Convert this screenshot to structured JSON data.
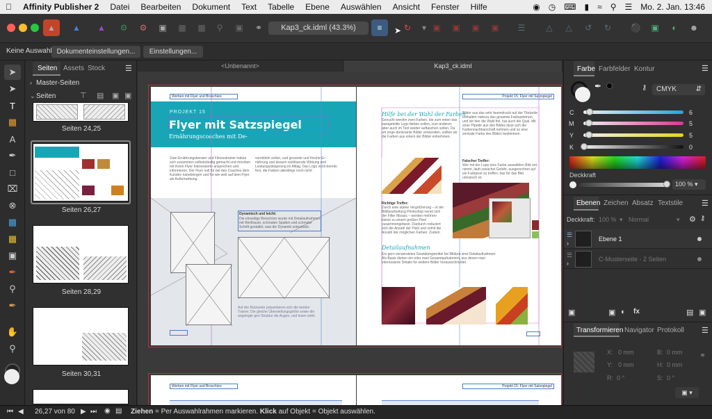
{
  "menubar": {
    "app_name": "Affinity Publisher 2",
    "items": [
      "Datei",
      "Bearbeiten",
      "Dokument",
      "Text",
      "Tabelle",
      "Ebene",
      "Auswählen",
      "Ansicht",
      "Fenster",
      "Hilfe"
    ],
    "datetime": "Mo. 2. Jan.  13:46"
  },
  "toolbar": {
    "document_title": "Kap3_ck.idml (43.3%)"
  },
  "contextbar": {
    "selection": "Keine Auswahl",
    "doc_settings": "Dokumenteinstellungen...",
    "settings": "Einstellungen..."
  },
  "pages_panel": {
    "tabs": [
      "Seiten",
      "Assets",
      "Stock"
    ],
    "master_label": "Master-Seiten",
    "pages_label": "Seiten",
    "spreads": [
      "Seiten 24,25",
      "Seiten 26,27",
      "Seiten 28,29",
      "Seiten 30,31"
    ]
  },
  "canvas": {
    "tabs": [
      "<Unbenannt>",
      "Kap3_ck.idml"
    ],
    "left_page": {
      "running_head": "Werben mit Flyer und Broschüre",
      "kicker": "PROJEKT 15",
      "title": "Flyer mit Satzspiegel",
      "subtitle": "Ernährungscoaches mit De-",
      "body1": "Zwei Ernährungsberater und Fitnesstrainer haben sich zusammen selbstständig gemacht und möchten mit ihrem Flyer Interessierte an­sprechen und informieren. Der Flyer soll für bei den Coaches dem Kunden nahebringen und für wie weit auf dem Flyer als Außenwirkung.",
      "body2": "vermitteln sollen, und gesunde und frische Er­nährung und dessen wohltuende Wirkung und Leistungssteigerung im Alltag. Das Logo nicht bereits fest, die Farben allerdings noch nicht",
      "box_title": "Dynamisch und leicht:",
      "box_text": "Die einseitige Broschüre wurde mit Detailaufnahmen, mit Weißraum, schmalen Spalten und schmaler Schrift gestaltet, was die Dynamik unterstützt.",
      "caption": "Auf der Rückseite präsentieren sich die beiden Trainer. Die gleiche Überstellungsgröße sowie die angelegte geri­ Struktur die Augen, und lesen wirkt."
    },
    "right_page": {
      "running_head": "Projekt 15: Flyer mit Satzspiegel",
      "heading1": "Hilfe bei der Wahl der Farben",
      "text1": "Gesucht werden zwei Farben, die zum einen das zweigeteilte Logo färben sollen, zum ande­ren aber auch im Text wieder auftauchen sol­len. Da wir enge-dominante Bilder verwenden, sollten wir die Farben aus einem der Bilder ent­nehmen.",
      "text2": "Bilder aus das sehr beeindruckt auf der Titel­seite enthalten nahezu das gesamte Farbspekt­rum, und wir hier die Wahl fiel, hat auch die Qual. Mit einer Pipette aus des Bildes lässt sich die Farbennachbarschaft nehmen und so eine zentrale Farbe des Bildes bestimmen.",
      "tip_title": "Falscher Treffer:",
      "tip_text": "Wer mit der Lupe eine Farbe auswählen Bild ent­nimmt, läuft zunächst Gefahr, ausgerechnet auf ein Farbpixel zu treffen, das für das Bild untypisch ist.",
      "tip2_title": "Richtige Treffer:",
      "tip2_text": "Durch eine starke Vergrößerung – in der Bildbearbeitung Photoshop nennt sich der Filter Mosaic – werden mehrere kleine zu ei­nem großen Pixel zusammengefasst. Dar­durch reduziert sich die Anzahl der Pixel und somit die Anzahl der möglichen Farben. Zu­dem werden untypische Farbpixel reduziert.",
      "heading2": "Detailaufnahmen",
      "text3": "Ein gern verwendetes Gestaltungsmittel bei Bildern sind Detailaufnah­men. Als Basis dienen ein oder zwei Gesamtaufnahmen, aus denen man interessante Details für weitere Bilder herausschneidet."
    },
    "bottom_spread": {
      "left_head": "Werben mit Flyer und Broschüre",
      "right_head": "Projekt 15: Flyer mit Satzspiegel"
    }
  },
  "right_panel": {
    "color_tabs": [
      "Farbe",
      "Farbfelder",
      "Kontur"
    ],
    "color_model": "CMYK",
    "channels": [
      {
        "label": "C",
        "value": "6",
        "level": 0.06,
        "color": "#1aa9e0"
      },
      {
        "label": "M",
        "value": "5",
        "level": 0.05,
        "color": "#d63a93"
      },
      {
        "label": "Y",
        "value": "5",
        "level": 0.05,
        "color": "#e6d31e"
      },
      {
        "label": "K",
        "value": "0",
        "level": 0.0,
        "color": "#888888"
      }
    ],
    "opacity_label": "Deckkraft",
    "opacity_value": "100 %",
    "layer_tabs": [
      "Ebenen",
      "Zeichen",
      "Absatz",
      "Textstile"
    ],
    "layer_opacity_label": "Deckkraft:",
    "layer_opacity_value": "100 %",
    "blend_mode": "Normal",
    "layers": [
      "Ebene 1",
      "C-Musterseite - 2 Seiten"
    ],
    "transform_tabs": [
      "Transformieren",
      "Navigator",
      "Protokoll"
    ],
    "fields": [
      {
        "label": "X:",
        "value": "0 mm"
      },
      {
        "label": "B:",
        "value": "0 mm"
      },
      {
        "label": "Y:",
        "value": "0 mm"
      },
      {
        "label": "H:",
        "value": "0 mm"
      },
      {
        "label": "R:",
        "value": "0 °"
      },
      {
        "label": "S:",
        "value": "0 °"
      }
    ]
  },
  "statusbar": {
    "page_indicator": "26,27 von 80",
    "hint_bold1": "Ziehen",
    "hint_text1": " = Per Auswahlrahmen markieren. ",
    "hint_bold2": "Klick",
    "hint_text2": " auf Objekt = Objekt auswählen."
  },
  "colors": {
    "accent_teal": "#18a6b6",
    "ui_dark": "#2b2b2b"
  }
}
